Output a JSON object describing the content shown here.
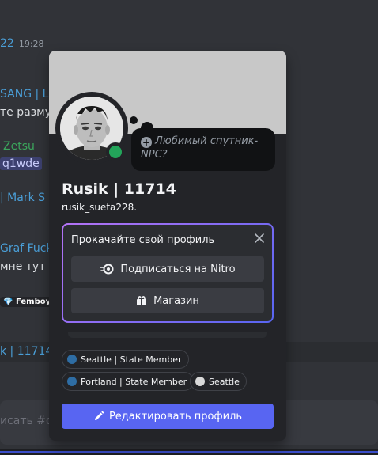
{
  "background_chat": {
    "lines": [
      {
        "text": "22",
        "time": "19:28"
      },
      {
        "text": "SANG | L"
      },
      {
        "text": "те размут"
      },
      {
        "text": "Zetsu"
      },
      {
        "text": "q1wde"
      },
      {
        "text": "| Mark S"
      },
      {
        "text": "Graf Fuck"
      },
      {
        "text": "мне тут р"
      },
      {
        "text": "Femboy"
      },
      {
        "text": "k | 11714"
      },
      {
        "text": "исать #о"
      }
    ]
  },
  "profile": {
    "display_name": "Rusik | 11714",
    "username": "rusik_sueta228.",
    "status_placeholder": "Любимый спутник-NPC?",
    "online_status": "online",
    "banner_color": "#c8c8c8",
    "status_color": "#23a55a"
  },
  "nitro_prompt": {
    "title": "Прокачайте свой профиль",
    "subscribe_label": "Подписаться на Nitro",
    "shop_label": "Магазин"
  },
  "roles": [
    {
      "name": "Seattle | State Member",
      "color": "#2e6da4"
    },
    {
      "name": "Portland | State Member",
      "color": "#2e6da4"
    },
    {
      "name": "Seattle",
      "color": "#d9d9d9"
    }
  ],
  "edit_profile_label": "Редактировать профиль",
  "colors": {
    "accent": "#5865f2",
    "popout_bg": "#232428"
  }
}
